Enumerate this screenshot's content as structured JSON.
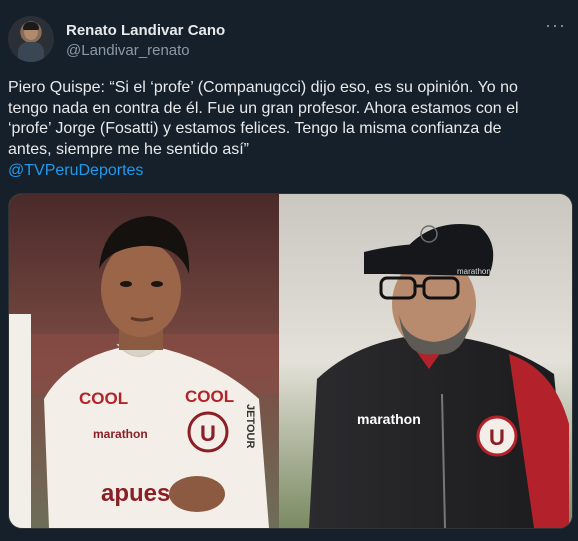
{
  "author": {
    "name": "Renato Landivar Cano",
    "handle": "@Landivar_renato"
  },
  "tweet": {
    "text": "Piero Quispe: “Si el ‘profe’ (Companugcci) dijo eso, es su opinión. Yo no\ntengo nada en contra de él. Fue un gran profesor. Ahora estamos con el\n‘profe’ Jorge (Fosatti) y estamos felices. Tengo la misma confianza de\nantes, siempre me he sentido así”",
    "mention": "@TVPeruDeportes"
  },
  "icons": {
    "more": "more-horizontal-icon"
  },
  "media": {
    "jersey_left": {
      "sponsor_a": "COOL",
      "sponsor_b": "COOL",
      "brand": "marathon",
      "crest": "U",
      "chest": "apuesta",
      "sleeve": "JETOUR"
    },
    "jersey_right": {
      "brand": "marathon",
      "crest": "U",
      "cap_brand": "marathon"
    }
  }
}
